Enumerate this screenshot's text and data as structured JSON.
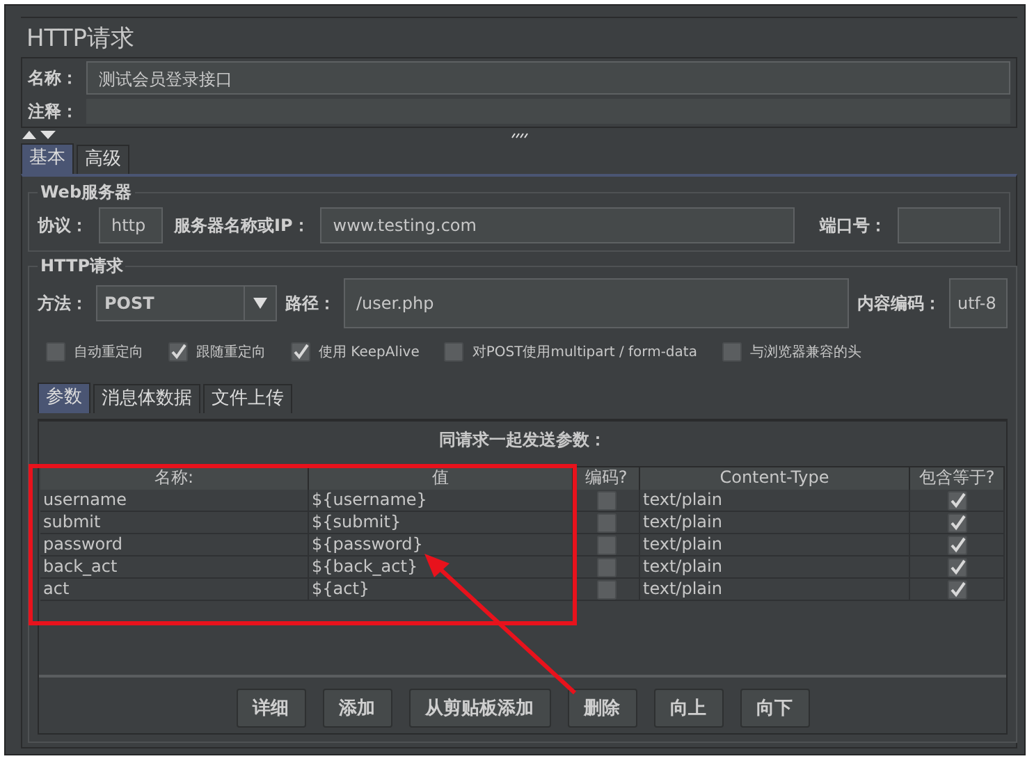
{
  "title": "HTTP请求",
  "name_field": {
    "label": "名称：",
    "value": "测试会员登录接口"
  },
  "comment_field": {
    "label": "注释："
  },
  "tabs": [
    {
      "label": "基本",
      "selected": true
    },
    {
      "label": "高级",
      "selected": false
    }
  ],
  "web_server": {
    "title": "Web服务器",
    "protocol_label": "协议：",
    "protocol": "http",
    "server_label": "服务器名称或IP：",
    "server": "www.testing.com",
    "port_label": "端口号："
  },
  "http_request": {
    "title": "HTTP请求",
    "method_label": "方法：",
    "method": "POST",
    "path_label": "路径：",
    "path": "/user.php",
    "encoding_label": "内容编码：",
    "encoding": "utf-8",
    "options": [
      {
        "label": "自动重定向",
        "checked": false
      },
      {
        "label": "跟随重定向",
        "checked": true
      },
      {
        "label": "使用 KeepAlive",
        "checked": true
      },
      {
        "label": "对POST使用multipart / form-data",
        "checked": false
      },
      {
        "label": "与浏览器兼容的头",
        "checked": false
      }
    ]
  },
  "sub_tabs": [
    {
      "label": "参数",
      "selected": true
    },
    {
      "label": "消息体数据",
      "selected": false
    },
    {
      "label": "文件上传",
      "selected": false
    }
  ],
  "params": {
    "title": "同请求一起发送参数：",
    "columns": [
      "名称:",
      "值",
      "编码?",
      "Content-Type",
      "包含等于?"
    ],
    "rows": [
      {
        "name": "username",
        "value": "${username}",
        "encode": false,
        "content_type": "text/plain",
        "include_equals": true
      },
      {
        "name": "submit",
        "value": "${submit}",
        "encode": false,
        "content_type": "text/plain",
        "include_equals": true
      },
      {
        "name": "password",
        "value": "${password}",
        "encode": false,
        "content_type": "text/plain",
        "include_equals": true
      },
      {
        "name": "back_act",
        "value": "${back_act}",
        "encode": false,
        "content_type": "text/plain",
        "include_equals": true
      },
      {
        "name": "act",
        "value": "${act}",
        "encode": false,
        "content_type": "text/plain",
        "include_equals": true
      }
    ]
  },
  "buttons": [
    "详细",
    "添加",
    "从剪贴板添加",
    "删除",
    "向上",
    "向下"
  ]
}
